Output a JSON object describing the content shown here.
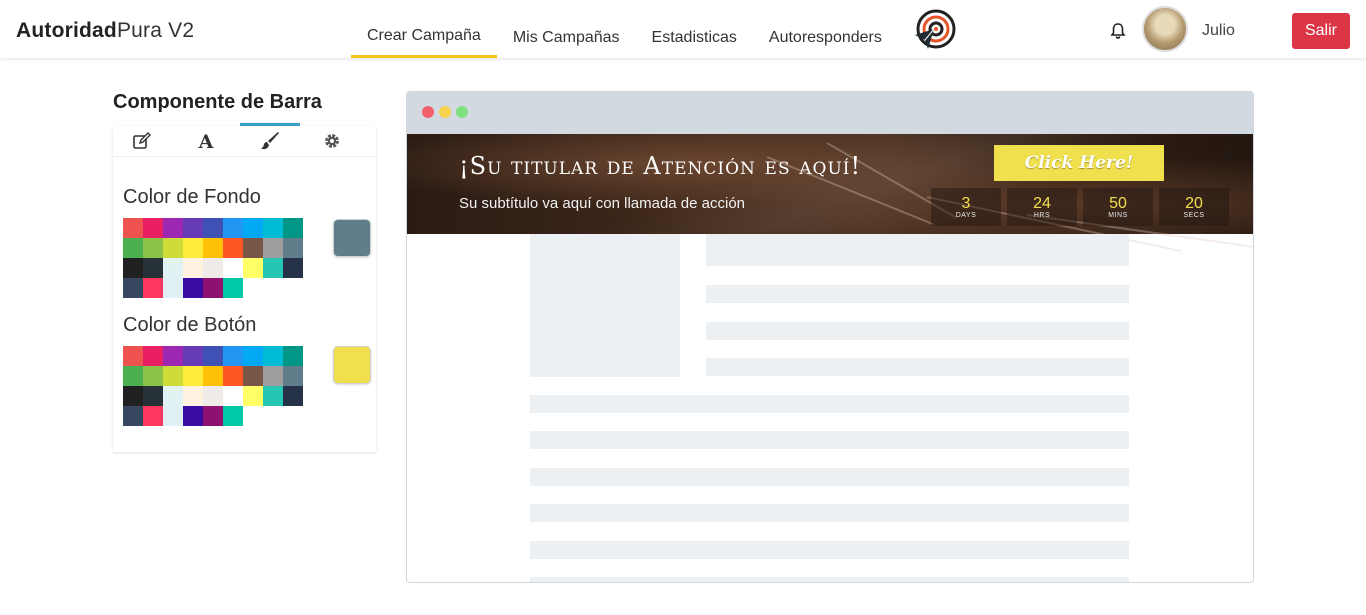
{
  "brand": {
    "bold": "Autoridad",
    "light": "Pura V2"
  },
  "nav": {
    "items": [
      {
        "label": "Crear Campaña",
        "active": true
      },
      {
        "label": "Mis Campañas",
        "active": false
      },
      {
        "label": "Estadisticas",
        "active": false
      },
      {
        "label": "Autoresponders",
        "active": false
      }
    ]
  },
  "user": {
    "name": "Julio",
    "logout_label": "Salir"
  },
  "panel": {
    "title": "Componente de Barra",
    "tabs": [
      {
        "icon": "edit-icon",
        "active": false
      },
      {
        "icon": "font-icon",
        "active": false
      },
      {
        "icon": "paintbrush-icon",
        "active": true
      },
      {
        "icon": "gear-icon",
        "active": false
      }
    ],
    "background_color": {
      "label": "Color de Fondo",
      "selected": "#607d8b"
    },
    "button_color": {
      "label": "Color de Botón",
      "selected": "#f1e04e"
    },
    "palette": [
      "#ef5350",
      "#e91e63",
      "#9c27b0",
      "#673ab7",
      "#3f51b5",
      "#2196f3",
      "#03a9f4",
      "#00bcd4",
      "#009688",
      "#4caf50",
      "#8bc34a",
      "#cddc39",
      "#ffeb3b",
      "#ffc107",
      "#ff5722",
      "#795548",
      "#9e9e9e",
      "#607d8b",
      "#212121",
      "#263238",
      "#e0f2f1",
      "#fff3e0",
      "#efebe9",
      "#ffffff",
      "#ffff66",
      "#26c6b5",
      "#263248",
      "#37475f",
      "#ff3860",
      "#e0f0f4",
      "#3a0ca3",
      "#8e1170",
      "#00c9a7"
    ]
  },
  "preview": {
    "dots": [
      "#f25f6c",
      "#f4d44d",
      "#7fe07f"
    ],
    "bar": {
      "title": "¡Su titular de Atención es aquí!",
      "subtitle": "Su subtítulo va aquí con llamada de acción",
      "button_label": "Click Here!",
      "close_label": "×",
      "countdown": [
        {
          "value": "3",
          "unit": "DAYS"
        },
        {
          "value": "24",
          "unit": "HRS"
        },
        {
          "value": "50",
          "unit": "MINS"
        },
        {
          "value": "20",
          "unit": "SECS"
        }
      ]
    }
  }
}
